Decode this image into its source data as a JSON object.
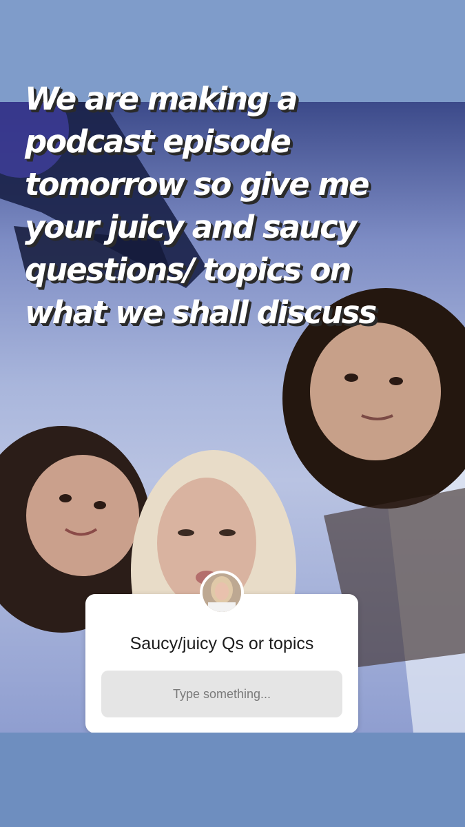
{
  "story": {
    "caption": "We are making a podcast episode tomorrow so give me your juicy and saucy questions/ topics on what we shall discuss"
  },
  "question_sticker": {
    "question": "Saucy/juicy Qs or topics",
    "answer_placeholder": "Type something...",
    "avatar_icon": "profile-avatar"
  },
  "colors": {
    "band": "#7f9cca",
    "sticker_bg": "#ffffff",
    "input_bg": "#e5e5e5"
  }
}
